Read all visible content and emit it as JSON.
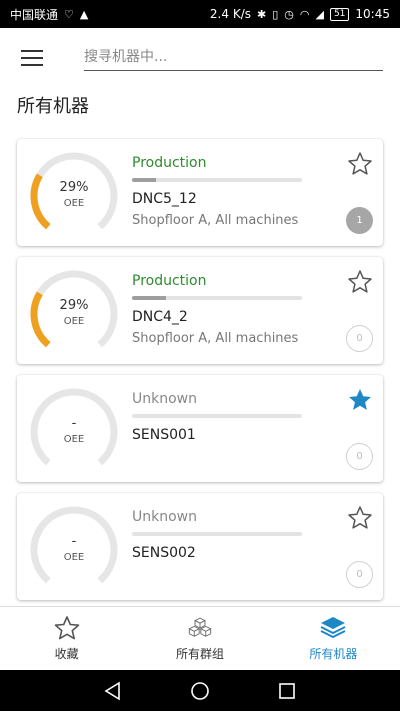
{
  "statusbar": {
    "carrier": "中国联通",
    "speed": "2.4 K/s",
    "battery": "51",
    "time": "10:45"
  },
  "search": {
    "placeholder": "搜寻机器中..."
  },
  "page_title": "所有机器",
  "machines": [
    {
      "oee": "29%",
      "oee_label": "OEE",
      "oee_fraction": 0.29,
      "status": "Production",
      "status_color": "#2e8b2e",
      "status_fill": 0.14,
      "name": "DNC5_12",
      "location": "Shopfloor A, All machines",
      "favorite": false,
      "count": "1"
    },
    {
      "oee": "29%",
      "oee_label": "OEE",
      "oee_fraction": 0.29,
      "status": "Production",
      "status_color": "#2e8b2e",
      "status_fill": 0.2,
      "name": "DNC4_2",
      "location": "Shopfloor A, All machines",
      "favorite": false,
      "count": "0"
    },
    {
      "oee": "-",
      "oee_label": "OEE",
      "oee_fraction": 0,
      "status": "Unknown",
      "status_color": "#888888",
      "status_fill": 0,
      "name": "SENS001",
      "location": "",
      "favorite": true,
      "count": "0"
    },
    {
      "oee": "-",
      "oee_label": "OEE",
      "oee_fraction": 0,
      "status": "Unknown",
      "status_color": "#888888",
      "status_fill": 0,
      "name": "SENS002",
      "location": "",
      "favorite": false,
      "count": "0"
    }
  ],
  "bottomnav": {
    "favorites": "收藏",
    "groups": "所有群组",
    "machines": "所有机器"
  },
  "colors": {
    "accent": "#1e88c7",
    "gauge": "#f0a020",
    "gauge_track": "#e6e6e6",
    "favorite": "#1e88c7"
  }
}
